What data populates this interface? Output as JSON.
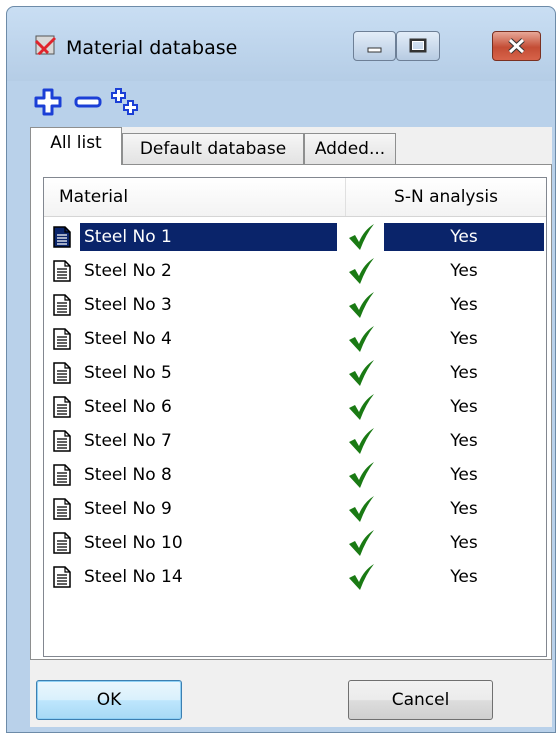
{
  "window": {
    "title": "Material database"
  },
  "toolbar": {
    "icons": [
      "add-icon",
      "remove-icon",
      "add-multiple-icon"
    ]
  },
  "tabs": [
    {
      "label": "All list",
      "active": true
    },
    {
      "label": "Default database",
      "active": false
    },
    {
      "label": "Added...",
      "active": false
    }
  ],
  "list": {
    "columns": {
      "material": "Material",
      "sn_analysis": "S-N analysis"
    },
    "rows": [
      {
        "name": "Steel No 1",
        "sn": "Yes",
        "selected": true
      },
      {
        "name": "Steel No 2",
        "sn": "Yes"
      },
      {
        "name": "Steel No 3",
        "sn": "Yes"
      },
      {
        "name": "Steel No 4",
        "sn": "Yes"
      },
      {
        "name": "Steel No 5",
        "sn": "Yes"
      },
      {
        "name": "Steel No 6",
        "sn": "Yes"
      },
      {
        "name": "Steel No 7",
        "sn": "Yes"
      },
      {
        "name": "Steel No 8",
        "sn": "Yes"
      },
      {
        "name": "Steel No 9",
        "sn": "Yes"
      },
      {
        "name": "Steel No 10",
        "sn": "Yes"
      },
      {
        "name": "Steel No 14",
        "sn": "Yes"
      }
    ]
  },
  "buttons": {
    "ok": "OK",
    "cancel": "Cancel"
  },
  "colors": {
    "selection": "#0a246a",
    "check": "#1a7a14",
    "toolbar_icon": "#1b3fd6"
  }
}
